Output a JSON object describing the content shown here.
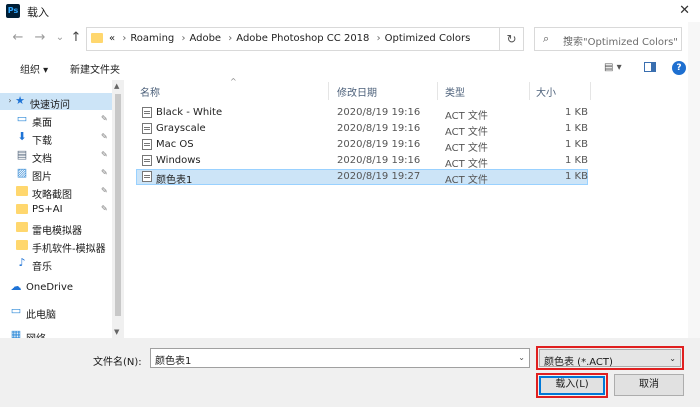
{
  "window": {
    "title": "载入",
    "app_icon": "Ps",
    "close_glyph": "✕"
  },
  "nav": {
    "back_glyph": "←",
    "forward_glyph": "→",
    "dropdown_glyph": "⌄",
    "up_glyph": "↑",
    "breadcrumb_prefix": "«",
    "breadcrumbs": [
      "Roaming",
      "Adobe",
      "Adobe Photoshop CC 2018",
      "Optimized Colors"
    ],
    "refresh_glyph": "↻",
    "search_placeholder": "搜索\"Optimized Colors\""
  },
  "toolbar": {
    "organize": "组织 ▾",
    "new_folder": "新建文件夹",
    "view_glyph": "▤ ▾",
    "help_glyph": "?"
  },
  "sidebar": {
    "items": [
      {
        "label": "快速访问",
        "icon": "star-icon",
        "glyph": "★",
        "selected": true,
        "pinned": false
      },
      {
        "label": "桌面",
        "icon": "desktop-icon",
        "glyph": "▭",
        "pinned": true
      },
      {
        "label": "下载",
        "icon": "download-icon",
        "glyph": "⬇",
        "pinned": true
      },
      {
        "label": "文档",
        "icon": "document-icon",
        "glyph": "▤",
        "pinned": true
      },
      {
        "label": "图片",
        "icon": "pictures-icon",
        "glyph": "▨",
        "pinned": true
      },
      {
        "label": "攻略截图",
        "icon": "folder-icon",
        "pinned": true
      },
      {
        "label": "PS+AI",
        "icon": "folder-icon",
        "pinned": true
      },
      {
        "label": "雷电模拟器",
        "icon": "folder-icon",
        "pinned": false
      },
      {
        "label": "手机软件-模拟器",
        "icon": "folder-icon",
        "pinned": false
      },
      {
        "label": "音乐",
        "icon": "music-icon",
        "glyph": "♪",
        "pinned": false
      },
      {
        "label": "OneDrive",
        "icon": "cloud-icon",
        "glyph": "☁",
        "pinned": false
      },
      {
        "label": "此电脑",
        "icon": "computer-icon",
        "glyph": "▭",
        "pinned": false
      },
      {
        "label": "网络",
        "icon": "network-icon",
        "glyph": "▦",
        "pinned": false
      }
    ],
    "pin_glyph": "📌"
  },
  "files": {
    "columns": [
      "名称",
      "修改日期",
      "类型",
      "大小"
    ],
    "rows": [
      {
        "name": "Black - White",
        "date": "2020/8/19 19:16",
        "type": "ACT 文件",
        "size": "1 KB"
      },
      {
        "name": "Grayscale",
        "date": "2020/8/19 19:16",
        "type": "ACT 文件",
        "size": "1 KB"
      },
      {
        "name": "Mac OS",
        "date": "2020/8/19 19:16",
        "type": "ACT 文件",
        "size": "1 KB"
      },
      {
        "name": "Windows",
        "date": "2020/8/19 19:16",
        "type": "ACT 文件",
        "size": "1 KB"
      },
      {
        "name": "颜色表1",
        "date": "2020/8/19 19:27",
        "type": "ACT 文件",
        "size": "1 KB",
        "selected": true
      }
    ]
  },
  "footer": {
    "filename_label": "文件名(N):",
    "filename_value": "颜色表1",
    "filetype_value": "颜色表 (*.ACT)",
    "ok_label": "载入(L)",
    "cancel_label": "取消"
  }
}
